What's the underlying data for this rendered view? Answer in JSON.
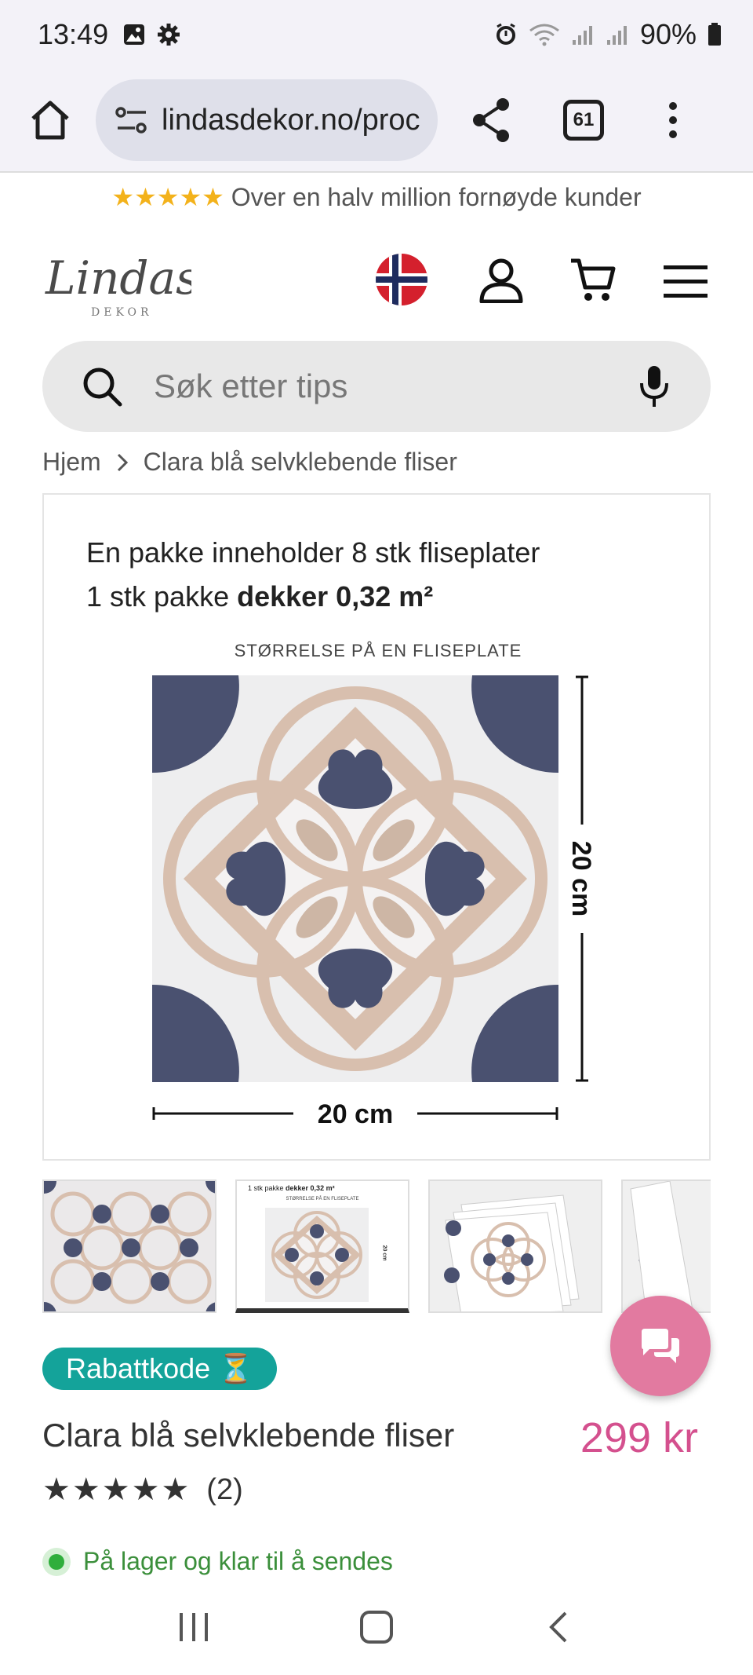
{
  "status_bar": {
    "time": "13:49",
    "battery": "90%",
    "icons": [
      "gallery-icon",
      "settings-icon",
      "alarm-icon",
      "wifi-icon",
      "signal-icon",
      "signal-icon",
      "battery-icon"
    ]
  },
  "browser": {
    "url": "lindasdekor.no/proc",
    "tab_count": "61"
  },
  "promo": {
    "stars": "★★★★★",
    "text": "Over en halv million fornøyde kunder"
  },
  "header": {
    "logo_name": "Lindas",
    "logo_sub": "DEKOR"
  },
  "search": {
    "placeholder": "Søk etter tips"
  },
  "breadcrumb": {
    "home": "Hjem",
    "current": "Clara blå selvklebende fliser"
  },
  "product_image": {
    "line1": "En pakke inneholder 8 stk fliseplater",
    "line2_prefix": "1 stk pakke ",
    "line2_bold": "dekker 0,32 m²",
    "caption": "STØRRELSE PÅ EN FLISEPLATE",
    "width_label": "20 cm",
    "height_label": "20 cm"
  },
  "thumbnails": {
    "thumb2_prefix": "1 stk pakke ",
    "thumb2_bold": "dekker 0,32 m²",
    "thumb2_caption": "STØRRELSE PÅ EN FLISEPLATE",
    "thumb2_dim": "20 cm"
  },
  "product": {
    "discount_label": "Rabattkode ⏳",
    "title": "Clara blå selvklebende fliser",
    "price": "299 kr",
    "rating_stars": "★★★★★",
    "rating_count": "(2)",
    "stock_text": "På lager og klar til å sendes"
  },
  "colors": {
    "accent_price": "#d4508e",
    "discount_bg": "#14a39a",
    "chat_fab": "#e27aa0",
    "tile_navy": "#4a5170",
    "tile_beige": "#d8bfae"
  }
}
